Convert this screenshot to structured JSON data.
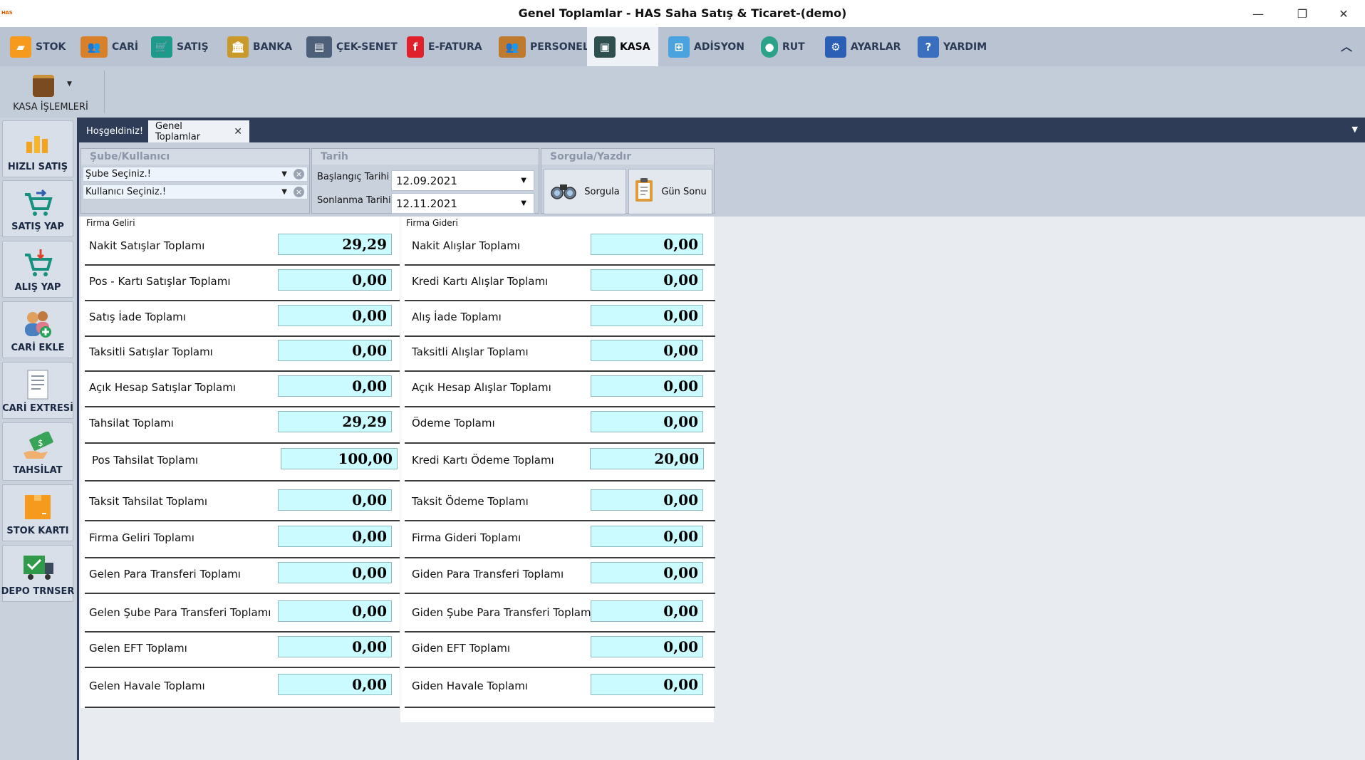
{
  "window": {
    "app_logo_text": "HAS",
    "title": "Genel Toplamlar - HAS Saha Satış & Ticaret-(demo)",
    "minimize": "—",
    "restore": "❐",
    "close": "✕"
  },
  "menu": {
    "items": [
      {
        "label": "STOK",
        "icon": "box-icon",
        "color": "#f59a1c"
      },
      {
        "label": "CARİ",
        "icon": "people-icon",
        "color": "#d8812a"
      },
      {
        "label": "SATIŞ",
        "icon": "cart-icon",
        "color": "#1e9a8a"
      },
      {
        "label": "BANKA",
        "icon": "bank-icon",
        "color": "#c99a2a"
      },
      {
        "label": "ÇEK-SENET",
        "icon": "book-icon",
        "color": "#4e5f7a"
      },
      {
        "label": "E-FATURA",
        "icon": "efatura-icon",
        "color": "#e0202a"
      },
      {
        "label": "PERSONEL",
        "icon": "staff-icon",
        "color": "#c07a30"
      },
      {
        "label": "KASA",
        "icon": "safe-icon",
        "color": "#2f4f4f"
      },
      {
        "label": "ADİSYON",
        "icon": "table-icon",
        "color": "#4aa3df"
      },
      {
        "label": "RUT",
        "icon": "pin-icon",
        "color": "#2aa389"
      },
      {
        "label": "AYARLAR",
        "icon": "gear-icon",
        "color": "#2b5fb5"
      },
      {
        "label": "YARDIM",
        "icon": "help-icon",
        "color": "#3a6fc0"
      }
    ],
    "collapse_glyph": "︿"
  },
  "ribbon": {
    "kasa_islemleri": "KASA İŞLEMLERİ"
  },
  "sidebar": {
    "items": [
      {
        "label": "HIZLI SATIŞ",
        "icon": "bar-chart-icon"
      },
      {
        "label": "SATIŞ YAP",
        "icon": "cart-sell-icon"
      },
      {
        "label": "ALIŞ YAP",
        "icon": "cart-buy-icon"
      },
      {
        "label": "CARİ EKLE",
        "icon": "add-customer-icon"
      },
      {
        "label": "CARİ EXTRESİ",
        "icon": "statement-icon"
      },
      {
        "label": "TAHSİLAT",
        "icon": "money-icon"
      },
      {
        "label": "STOK KARTI",
        "icon": "box-icon"
      },
      {
        "label": "DEPO TRNSER",
        "icon": "truck-icon"
      }
    ]
  },
  "tabs": [
    {
      "label": "Hoşgeldiniz!"
    },
    {
      "label": "Genel Toplamlar",
      "close": "✕"
    }
  ],
  "filters": {
    "sube_group_title": "Şube/Kullanıcı",
    "sube_placeholder": "Şube Seçiniz.!",
    "kullanici_placeholder": "Kullanıcı Seçiniz.!",
    "tarih_group_title": "Tarih",
    "baslangic_label": "Başlangıç Tarihi",
    "baslangic_value": "12.09.2021",
    "sonlanma_label": "Sonlanma Tarihi",
    "sonlanma_value": "12.11.2021",
    "sorgula_group_title": "Sorgula/Yazdır",
    "sorgula_button": "Sorgula",
    "gunsonu_button": "Gün Sonu"
  },
  "gelir": {
    "title": "Firma Geliri",
    "rows": [
      {
        "label": "Nakit Satışlar Toplamı",
        "value": "29,29"
      },
      {
        "label": "Pos - Kartı Satışlar Toplamı",
        "value": "0,00"
      },
      {
        "label": "Satış İade Toplamı",
        "value": "0,00"
      },
      {
        "label": "Taksitli Satışlar Toplamı",
        "value": "0,00"
      },
      {
        "label": "Açık Hesap Satışlar Toplamı",
        "value": "0,00"
      },
      {
        "label": "Tahsilat Toplamı",
        "value": "29,29"
      },
      {
        "label": "Pos Tahsilat Toplamı",
        "value": "100,00"
      },
      {
        "label": "Taksit Tahsilat Toplamı",
        "value": "0,00"
      },
      {
        "label": "Firma Geliri Toplamı",
        "value": "0,00"
      },
      {
        "label": "Gelen Para Transferi Toplamı",
        "value": "0,00"
      },
      {
        "label": "Gelen Şube Para Transferi Toplamı",
        "value": "0,00"
      },
      {
        "label": "Gelen EFT Toplamı",
        "value": "0,00"
      },
      {
        "label": "Gelen Havale Toplamı",
        "value": "0,00"
      }
    ]
  },
  "gider": {
    "title": "Firma Gideri",
    "rows": [
      {
        "label": "Nakit Alışlar Toplamı",
        "value": "0,00"
      },
      {
        "label": "Kredi Kartı Alışlar Toplamı",
        "value": "0,00"
      },
      {
        "label": "Alış İade Toplamı",
        "value": "0,00"
      },
      {
        "label": "Taksitli Alışlar Toplamı",
        "value": "0,00"
      },
      {
        "label": "Açık Hesap Alışlar Toplamı",
        "value": "0,00"
      },
      {
        "label": "Ödeme Toplamı",
        "value": "0,00"
      },
      {
        "label": "Kredi Kartı Ödeme Toplamı",
        "value": "20,00"
      },
      {
        "label": "Taksit Ödeme Toplamı",
        "value": "0,00"
      },
      {
        "label": "Firma Gideri Toplamı",
        "value": "0,00"
      },
      {
        "label": "Giden Para Transferi Toplamı",
        "value": "0,00"
      },
      {
        "label": "Giden Şube Para Transferi Toplamı",
        "value": "0,00"
      },
      {
        "label": "Giden EFT Toplamı",
        "value": "0,00"
      },
      {
        "label": "Giden Havale Toplamı",
        "value": "0,00"
      }
    ]
  }
}
